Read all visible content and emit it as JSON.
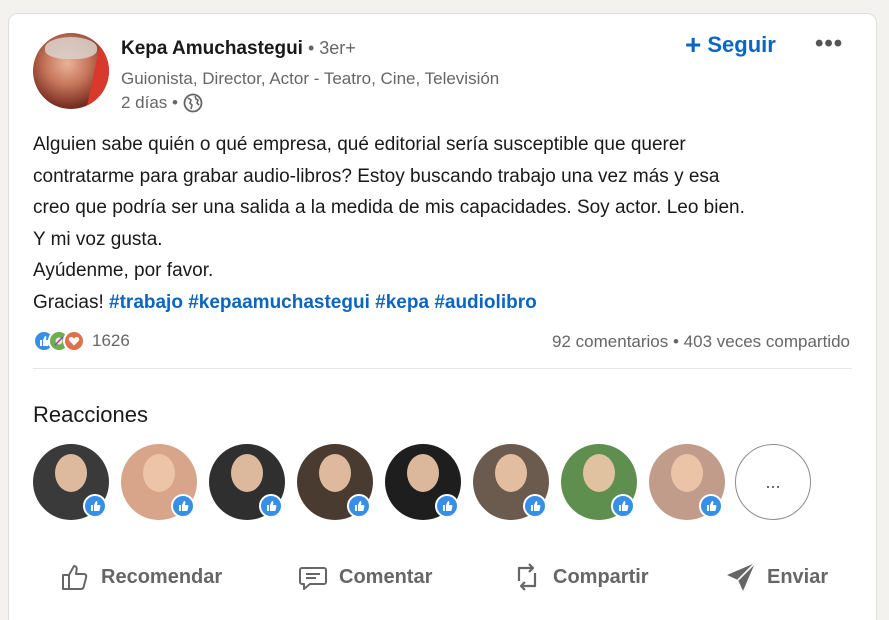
{
  "post": {
    "author_name": "Kepa Amuchastegui",
    "author_degree": " • 3er+",
    "author_headline": "Guionista, Director, Actor - Teatro, Cine, Televisión",
    "time": "2 días •",
    "follow_label": "Seguir",
    "more_label": "•••",
    "text_lines": [
      "Alguien sabe quién o qué empresa, qué editorial sería susceptible que querer",
      "contratarme para grabar audio-libros? Estoy buscando trabajo una vez más y esa",
      "creo que podría ser una salida a la medida de mis capacidades. Soy actor. Leo bien.",
      "Y mi voz gusta.",
      "Ayúdenme, por favor.",
      "Gracias! "
    ],
    "hashtags": [
      "#trabajo",
      "#kepaamuchastegui",
      "#kepa",
      "#audiolibro"
    ]
  },
  "social": {
    "reaction_count": "1626",
    "comments": "92 comentarios",
    "separator": " • ",
    "shares": "403 veces compartido"
  },
  "reactions": {
    "title": "Reacciones",
    "more_label": "...",
    "faces": [
      {
        "bg": "#3a3a3a"
      },
      {
        "bg": "#d8a48a"
      },
      {
        "bg": "#2f2f2f"
      },
      {
        "bg": "#4a3b30"
      },
      {
        "bg": "#1e1e1e"
      },
      {
        "bg": "#6b5a4e"
      },
      {
        "bg": "#5f8f4e"
      },
      {
        "bg": "#c29c8a"
      }
    ]
  },
  "actions": {
    "like": "Recomendar",
    "comment": "Comentar",
    "repost": "Compartir",
    "send": "Enviar"
  },
  "colors": {
    "brand_blue": "#0a66c2",
    "like_blue": "#378fe9",
    "muted_text": "#666666"
  }
}
